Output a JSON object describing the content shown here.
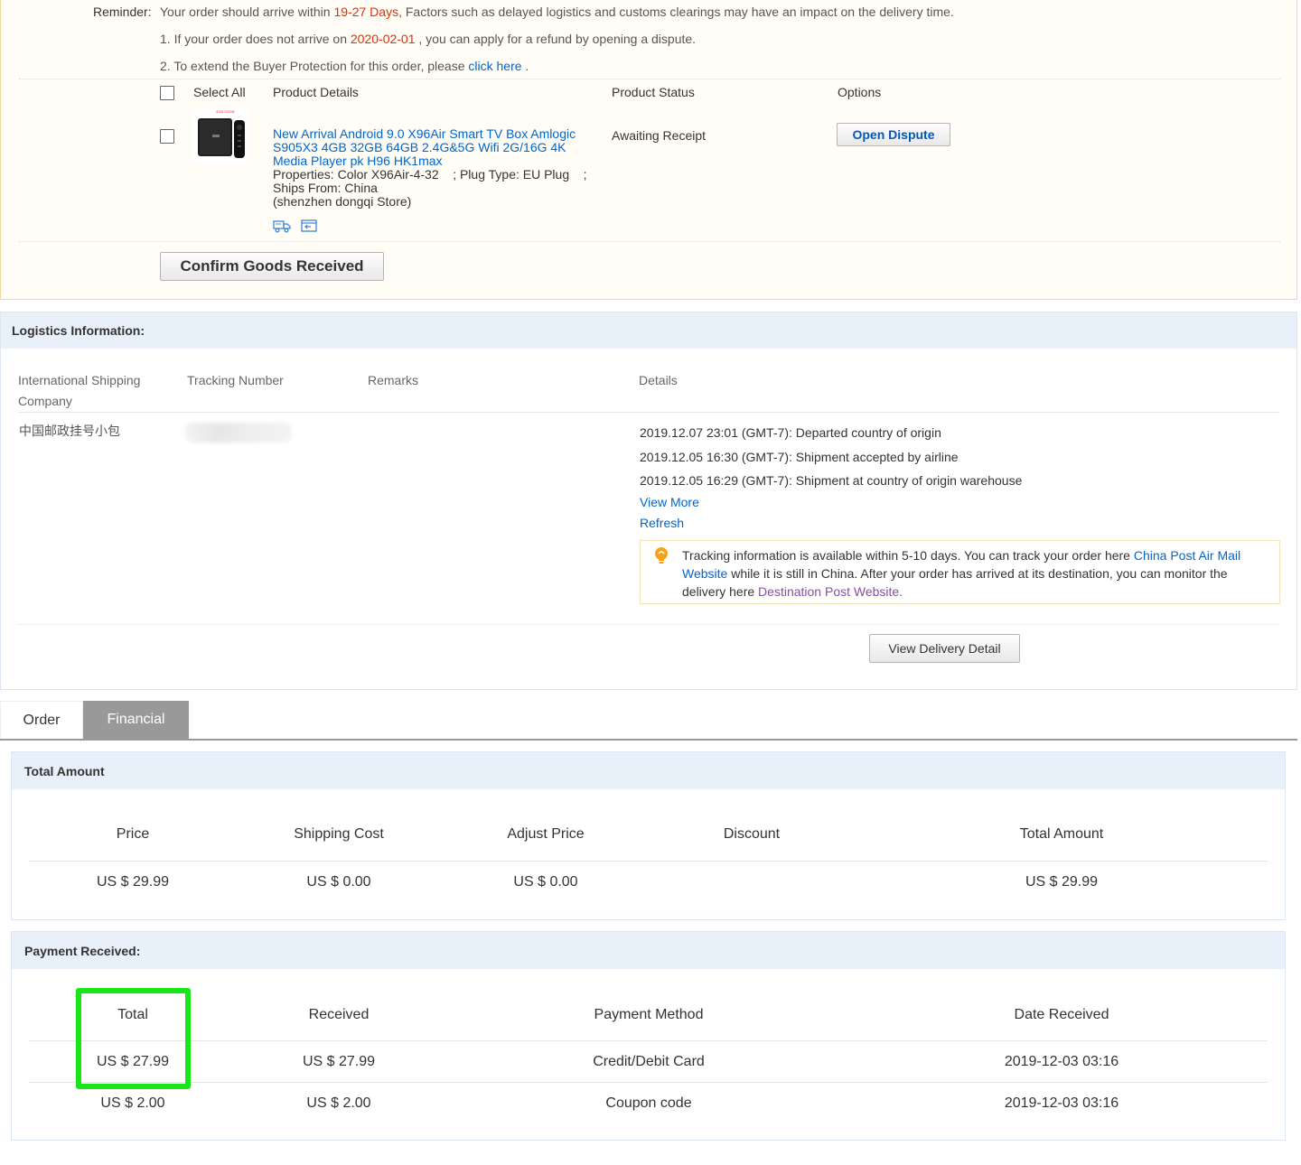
{
  "reminder": {
    "label": "Reminder:",
    "line1_a": "Your order should arrive within ",
    "line1_days": "19-27 Days",
    "line1_b": ", Factors such as delayed logistics and customs clearings may have an impact on the delivery time.",
    "line2_a": "1. If your order does not arrive on ",
    "line2_date": "2020-02-01",
    "line2_b": " , you can apply for a refund by opening a dispute.",
    "line3_a": "2. To extend the Buyer Protection for this order, please ",
    "line3_link": "click here",
    "line3_b": " ."
  },
  "products_table": {
    "select_all": "Select All",
    "col_details": "Product Details",
    "col_status": "Product Status",
    "col_options": "Options",
    "item": {
      "title": "New Arrival Android 9.0 X96Air Smart TV Box Amlogic S905X3 4GB 32GB 64GB 2.4G&5G Wifi 2G/16G 4K Media Player pk H96 HK1max",
      "properties": "Properties: Color X96Air-4-32    ; Plug Type: EU Plug    ;",
      "ships_from": "Ships From: China",
      "store": "(shenzhen dongqi Store)",
      "status": "Awaiting Receipt",
      "option_button": "Open Dispute",
      "thumb_label": "4GB+32GB",
      "icons": [
        "delivery-truck-icon",
        "snapshot-icon"
      ]
    },
    "confirm_button": "Confirm Goods Received"
  },
  "logistics": {
    "title": "Logistics Information:",
    "col_company": "International Shipping Company",
    "col_tracking": "Tracking Number",
    "col_remarks": "Remarks",
    "col_details": "Details",
    "company": "中国邮政挂号小包",
    "events": [
      "2019.12.07 23:01 (GMT-7): Departed country of origin",
      "2019.12.05 16:30 (GMT-7): Shipment accepted by airline",
      "2019.12.05 16:29 (GMT-7): Shipment at country of origin warehouse"
    ],
    "view_more": "View More",
    "refresh": "Refresh",
    "tip_a": "Tracking information is available within 5-10 days. You can track your order here ",
    "tip_link1": "China Post Air Mail Website",
    "tip_b": " while it is still in China. After your order has arrived at its destination, you can monitor the delivery here ",
    "tip_link2": "Destination Post Website",
    "tip_c": ".",
    "view_delivery_button": "View Delivery Detail"
  },
  "tabs": [
    {
      "label": "Order",
      "active": false
    },
    {
      "label": "Financial",
      "active": true
    }
  ],
  "total_amount": {
    "title": "Total Amount",
    "headers": [
      "Price",
      "Shipping Cost",
      "Adjust Price",
      "Discount",
      "Total Amount"
    ],
    "values": [
      "US $ 29.99",
      "US $ 0.00",
      "US $ 0.00",
      "",
      "US $ 29.99"
    ]
  },
  "payment_received": {
    "title": "Payment Received:",
    "headers": [
      "Total",
      "Received",
      "Payment Method",
      "Date Received"
    ],
    "rows": [
      [
        "US $ 27.99",
        "US $ 27.99",
        "Credit/Debit Card",
        "2019-12-03 03:16"
      ],
      [
        "US $ 2.00",
        "US $ 2.00",
        "Coupon code",
        "2019-12-03 03:16"
      ]
    ]
  },
  "colors": {
    "accent_red": "#e62e04",
    "link_blue": "#0066cc",
    "highlight_green": "#19e619",
    "panel_header": "#e8f0fa"
  }
}
